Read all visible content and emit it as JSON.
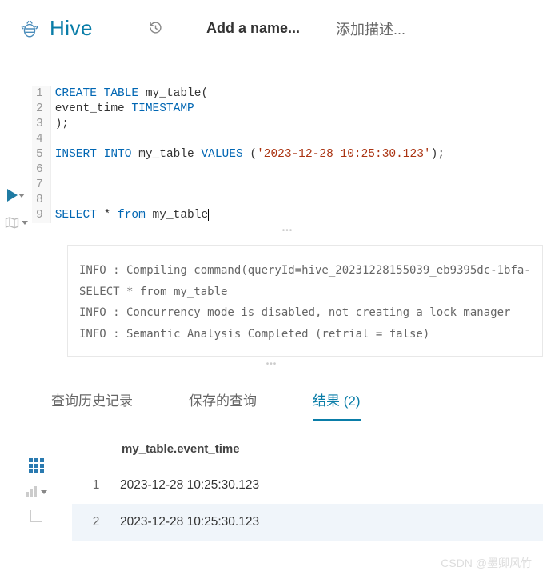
{
  "header": {
    "logo": "Hive",
    "add_name": "Add a name...",
    "add_desc": "添加描述..."
  },
  "code": {
    "line_numbers": [
      "1",
      "2",
      "3",
      "4",
      "5",
      "6",
      "7",
      "8",
      "9"
    ],
    "tokens": {
      "l1_kw1": "CREATE",
      "l1_kw2": "TABLE",
      "l1_txt": " my_table(",
      "l2_txt1": "    event_time ",
      "l2_kw": "TIMESTAMP",
      "l3_txt": ");",
      "l5_kw1": "INSERT",
      "l5_kw2": "INTO",
      "l5_txt1": " my_table ",
      "l5_kw3": "VALUES",
      "l5_txt2": " (",
      "l5_str": "'2023-12-28 10:25:30.123'",
      "l5_txt3": ");",
      "l9_kw1": "SELECT",
      "l9_txt1": " * ",
      "l9_kw2": "from",
      "l9_txt2": "  my_table"
    }
  },
  "log": {
    "l1": "INFO  : Compiling command(queryId=hive_20231228155039_eb9395dc-1bfa-",
    "l2": "SELECT * from  my_table",
    "l3": "INFO  : Concurrency mode is disabled, not creating a lock manager",
    "l4": "INFO  : Semantic Analysis Completed (retrial = false)"
  },
  "tabs": {
    "history": "查询历史记录",
    "saved": "保存的查询",
    "results": "结果 (2)"
  },
  "results": {
    "column_header": "my_table.event_time",
    "rows": [
      {
        "idx": "1",
        "value": "2023-12-28 10:25:30.123"
      },
      {
        "idx": "2",
        "value": "2023-12-28 10:25:30.123"
      }
    ]
  },
  "watermark": "CSDN @墨卿风竹"
}
